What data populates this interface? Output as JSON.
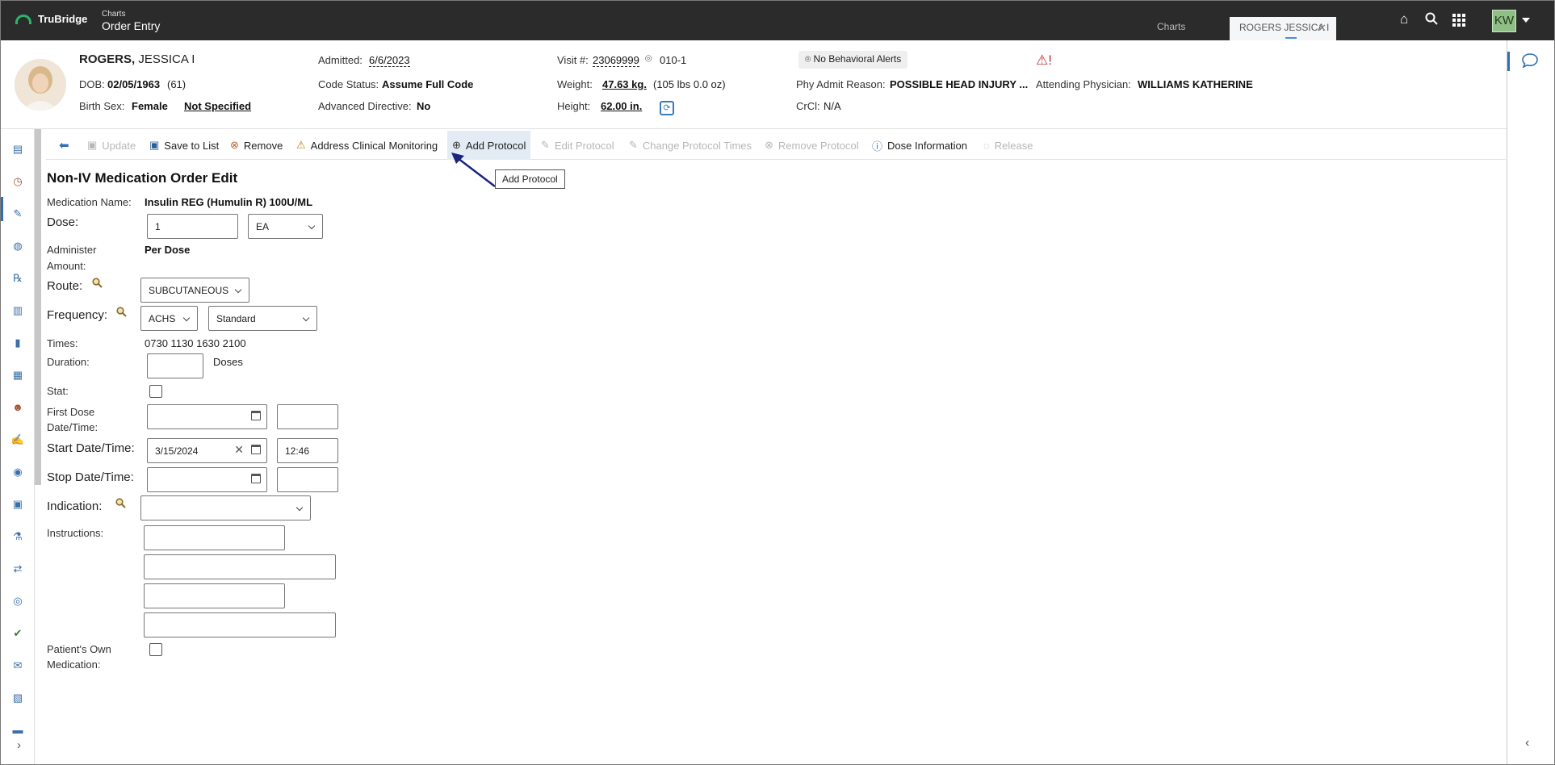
{
  "app": {
    "brand": "TruBridge",
    "crumb_top": "Charts",
    "crumb_main": "Order Entry"
  },
  "tabs": {
    "charts_label": "Charts",
    "patient_tab_label": "ROGERS JESSICA I"
  },
  "user": {
    "initials": "KW"
  },
  "icons": {
    "home": "home-icon",
    "search": "search-icon",
    "apps": "grid-icon",
    "chat": "chat-bubble-icon"
  },
  "patient": {
    "last_name": "ROGERS,",
    "first_name": "JESSICA I",
    "dob_label": "DOB:",
    "dob": "02/05/1963",
    "age": "(61)",
    "birth_sex_label": "Birth Sex:",
    "birth_sex": "Female",
    "gender_identity": "Not Specified",
    "admitted_label": "Admitted:",
    "admitted": "6/6/2023",
    "code_status_label": "Code Status:",
    "code_status": "Assume Full Code",
    "adv_directive_label": "Advanced Directive:",
    "adv_directive": "No",
    "visit_label": "Visit #:",
    "visit": "23069999",
    "room": "010-1",
    "weight_label": "Weight:",
    "weight": "47.63 kg.",
    "weight_alt": "(105 lbs 0.0 oz)",
    "height_label": "Height:",
    "height": "62.00 in.",
    "behavioral_alerts": "No Behavioral Alerts",
    "admit_reason_label": "Phy Admit Reason:",
    "admit_reason": "POSSIBLE HEAD INJURY ...",
    "crcl_label": "CrCl:",
    "crcl": "N/A",
    "attending_label": "Attending Physician:",
    "attending": "WILLIAMS KATHERINE"
  },
  "toolbar": {
    "update": "Update",
    "save_to_list": "Save to List",
    "remove": "Remove",
    "address_clinical": "Address Clinical Monitoring",
    "add_protocol": "Add Protocol",
    "edit_protocol": "Edit Protocol",
    "change_protocol_times": "Change Protocol Times",
    "remove_protocol": "Remove Protocol",
    "dose_information": "Dose Information",
    "release": "Release",
    "tooltip": "Add Protocol"
  },
  "form": {
    "title": "Non-IV Medication Order Edit",
    "med_name_label": "Medication Name:",
    "med_name": "Insulin REG (Humulin R) 100U/ML",
    "dose_label": "Dose:",
    "dose_value": "1",
    "dose_unit": "EA",
    "administer_label_1": "Administer",
    "administer_label_2": "Amount:",
    "administer_value": "Per Dose",
    "route_label": "Route:",
    "route_value": "SUBCUTANEOUS",
    "frequency_label": "Frequency:",
    "frequency_value": "ACHS",
    "frequency_type": "Standard",
    "times_label": "Times:",
    "times_value": "0730 1130 1630 2100",
    "duration_label": "Duration:",
    "duration_unit": "Doses",
    "stat_label": "Stat:",
    "first_dose_label_1": "First Dose",
    "first_dose_label_2": "Date/Time:",
    "start_label": "Start Date/Time:",
    "start_date": "3/15/2024",
    "start_time": "12:46",
    "stop_label": "Stop Date/Time:",
    "indication_label": "Indication:",
    "instructions_label": "Instructions:",
    "pom_label_1": "Patient's Own",
    "pom_label_2": "Medication:"
  }
}
